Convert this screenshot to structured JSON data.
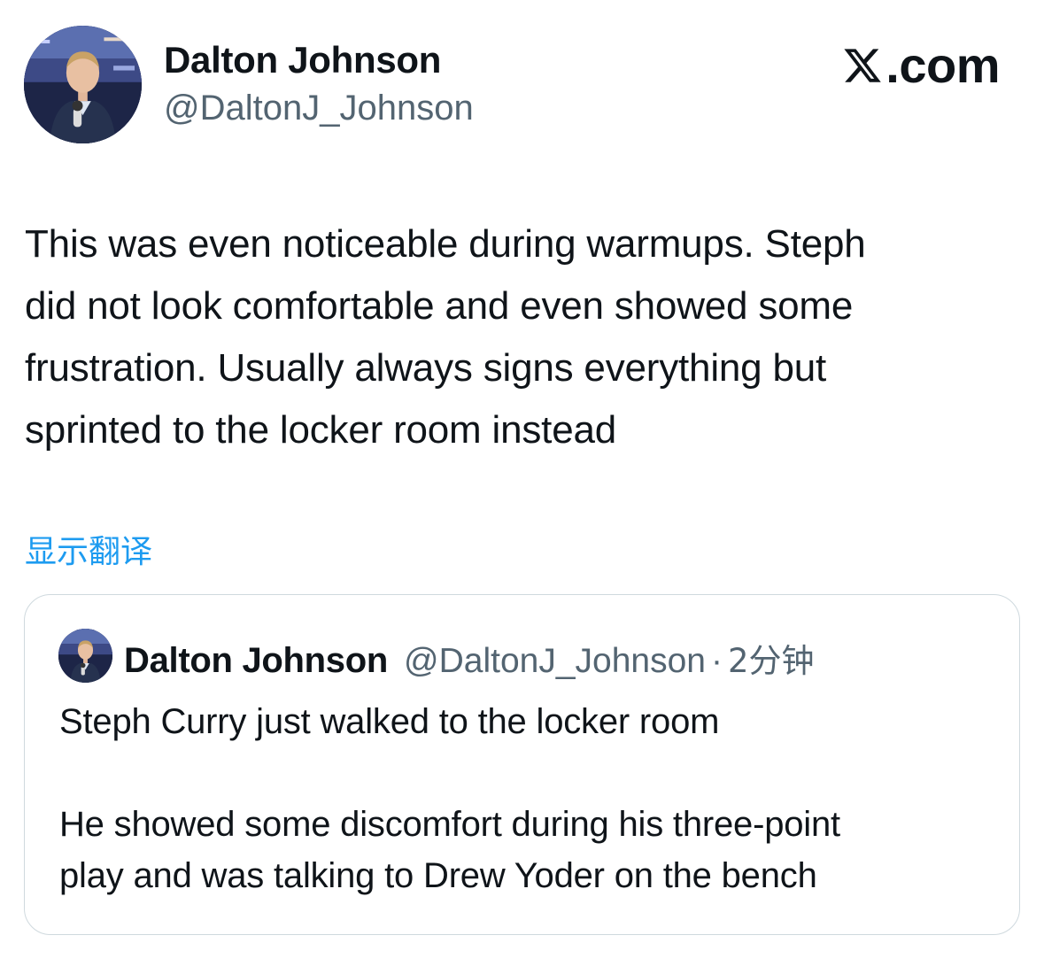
{
  "author": {
    "name": "Dalton Johnson",
    "handle": "@DaltonJ_Johnson"
  },
  "brand": {
    "label": ".com",
    "icon": "x-logo-icon"
  },
  "tweet": {
    "lines": [
      "This was even noticeable during warmups. Steph",
      "did not look comfortable and even showed some",
      "frustration. Usually always signs everything but",
      "sprinted to the locker room instead"
    ],
    "translate_label": "显示翻译"
  },
  "quote": {
    "name": "Dalton Johnson",
    "handle": "@DaltonJ_Johnson",
    "separator": "·",
    "time": "2分钟",
    "paragraph1": "Steph Curry just walked to the locker room",
    "paragraph2_lines": [
      "He showed some discomfort during his three-point",
      "play and was talking to Drew Yoder on the bench"
    ]
  },
  "colors": {
    "link": "#1d9bf0",
    "secondary_text": "#536471",
    "card_border": "#cfd9de"
  }
}
